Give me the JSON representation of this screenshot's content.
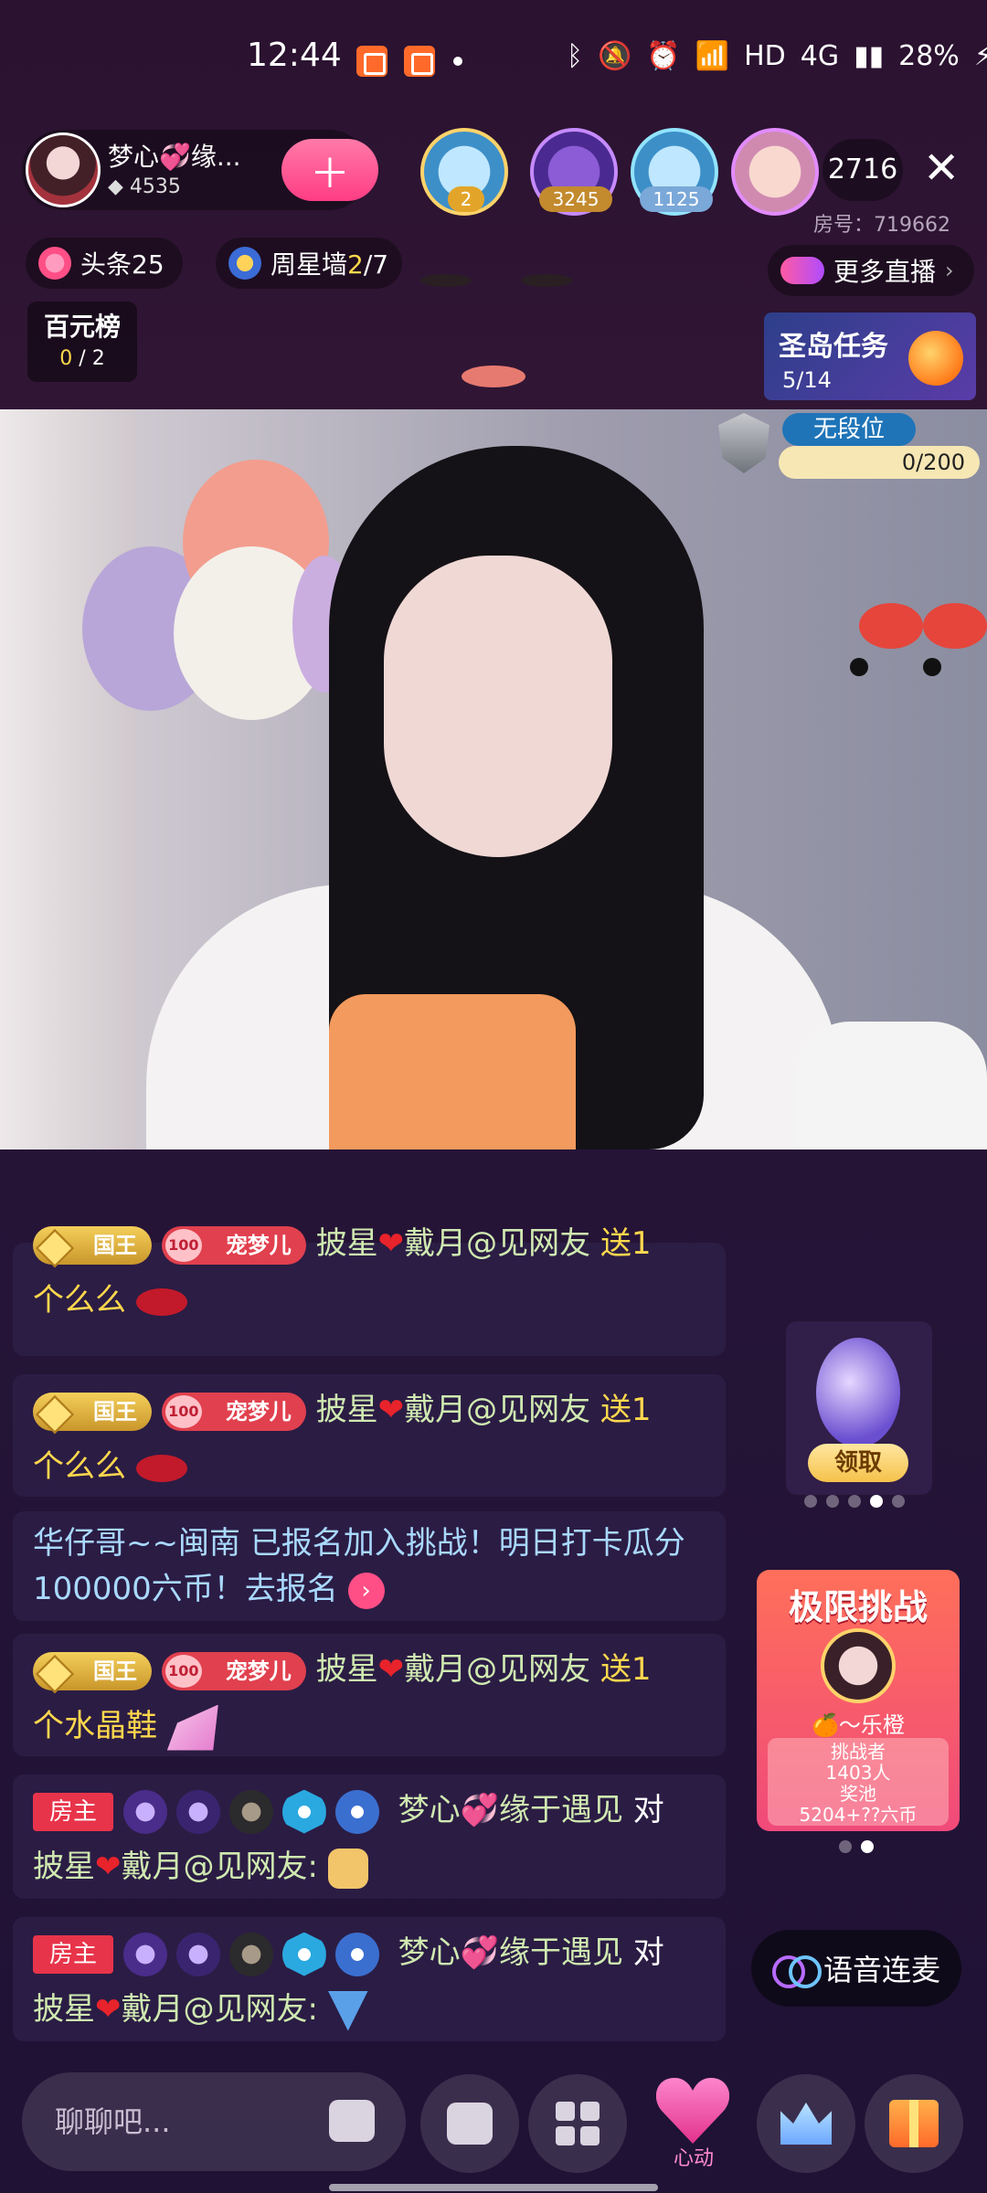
{
  "status_bar": {
    "time": "12:44",
    "network": "HD",
    "signal": "4G",
    "battery": "28%"
  },
  "header": {
    "anchor_name": "梦心💞缘...",
    "anchor_score": "4535",
    "viewers": [
      {
        "badge": "2"
      },
      {
        "badge": "3245"
      },
      {
        "badge": "1125"
      },
      {
        "badge": ""
      }
    ],
    "online_count": "2716",
    "room_number": "房号：719662"
  },
  "row2": {
    "headline": "头条25",
    "weekstar_prefix": "周星墙",
    "weekstar_progress": "2",
    "weekstar_total": "/7",
    "more_live": "更多直播"
  },
  "rank": {
    "title": "百元榜",
    "progress": "0",
    "total": " / 2"
  },
  "task": {
    "title": "圣岛任务",
    "count": "5/14"
  },
  "video_overlay": {
    "rank_label": "无段位",
    "rank_progress": "0/200"
  },
  "chat": [
    {
      "badge_king": "国王",
      "badge_pet": "宠梦儿",
      "user_pre": "披星",
      "user_post": "戴月@见网友",
      "gift_verb": "送1",
      "gift_name": "个么么"
    },
    {
      "badge_king": "国王",
      "badge_pet": "宠梦儿",
      "user_pre": "披星",
      "user_post": "戴月@见网友",
      "gift_verb": "送1",
      "gift_name": "个么么"
    },
    {
      "text": "华仔哥~~闽南 已报名加入挑战！明日打卡瓜分100000六币！去报名"
    },
    {
      "badge_king": "国王",
      "badge_pet": "宠梦儿",
      "user_pre": "披星",
      "user_post": "戴月@见网友",
      "gift_verb": "送1",
      "gift_name": "个水晶鞋"
    },
    {
      "host": "房主",
      "sender": "梦心💞缘于遇见",
      "verb": "对",
      "target_pre": "披星",
      "target_post": "戴月@见网友:"
    },
    {
      "host": "房主",
      "sender": "梦心💞缘于遇见",
      "verb": "对",
      "target_pre": "披星",
      "target_post": "戴月@见网友:"
    }
  ],
  "side": {
    "claim": "领取",
    "challenge_title": "极限挑战",
    "challenge_name": "🍊～乐橙",
    "challenger_label": "挑战者",
    "challenger_count": "1403人",
    "pool_label": "奖池",
    "pool_value": "5204+??六币",
    "voice_btn": "语音连麦"
  },
  "bottom": {
    "chat_placeholder": "聊聊吧...",
    "heart_label": "心动"
  },
  "colors": {
    "accent_pink": "#ff3d84",
    "gift_yellow": "#ffd84d",
    "user_green": "#cfe9b0",
    "system_blue": "#a9d9ff"
  }
}
